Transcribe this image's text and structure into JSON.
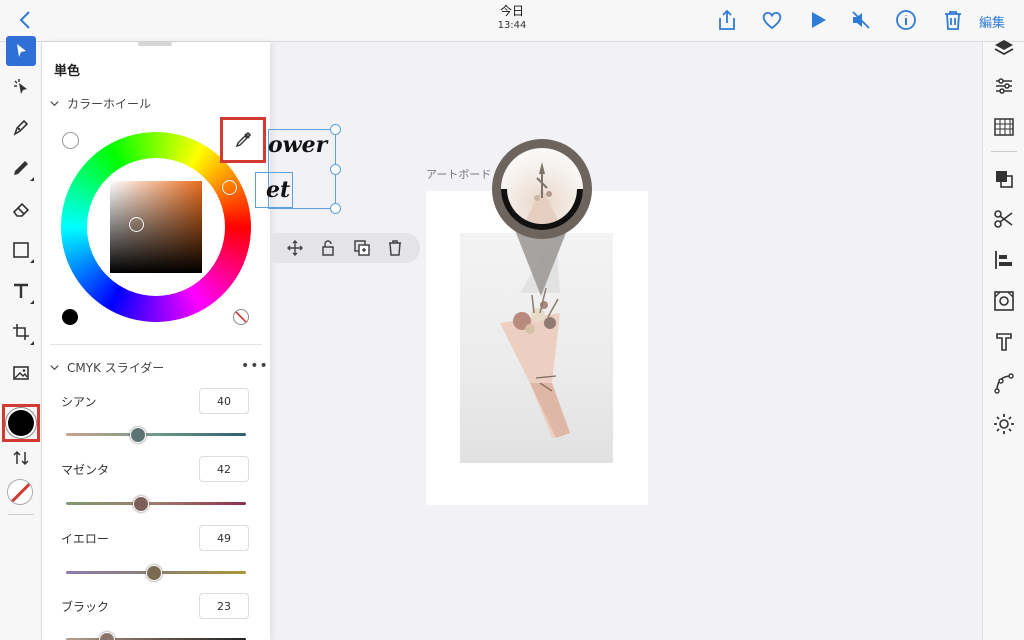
{
  "header": {
    "title": "今日",
    "time": "13:44",
    "edit_label": "編集"
  },
  "panel": {
    "mode_title": "単色",
    "wheel_section": "カラーホイール",
    "slider_section": "CMYK スライダー",
    "more": "•••",
    "selected_color": "#000000",
    "sliders": [
      {
        "label": "シアン",
        "value": "40"
      },
      {
        "label": "マゼンタ",
        "value": "42"
      },
      {
        "label": "イエロー",
        "value": "49"
      },
      {
        "label": "ブラック",
        "value": "23"
      }
    ]
  },
  "canvas": {
    "text_line1": "ower",
    "text_line2": "et",
    "artboard_label": "アートボード"
  },
  "colors": {
    "accent": "#2f7bd8",
    "highlight": "#d33a32"
  }
}
